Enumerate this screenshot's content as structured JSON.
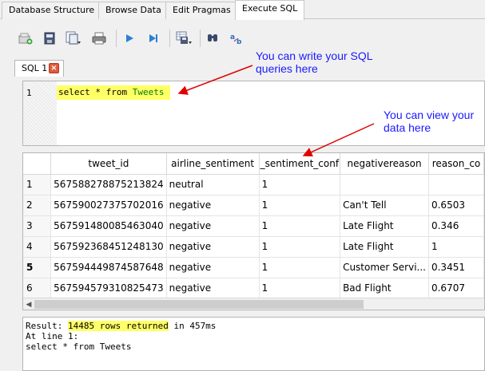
{
  "top_tabs": [
    "Database Structure",
    "Browse Data",
    "Edit Pragmas",
    "Execute SQL"
  ],
  "active_tab_index": 3,
  "toolbar_icons": [
    "open-tab-icon",
    "open-sql-icon",
    "save-sql-icon",
    "print-icon",
    "execute-all-icon",
    "execute-line-icon",
    "save-results-icon",
    "find-icon",
    "find-replace-icon"
  ],
  "sql_tab": {
    "label": "SQL 1"
  },
  "editor": {
    "line_number": "1",
    "query_keyword": "select * from ",
    "query_table": "Tweets"
  },
  "grid": {
    "columns": [
      "tweet_id",
      "airline_sentiment",
      "_sentiment_conf",
      "negativereason",
      "reason_co"
    ],
    "rows": [
      {
        "num": "1",
        "cells": [
          "567588278875213824",
          "neutral",
          "1",
          "",
          ""
        ]
      },
      {
        "num": "2",
        "cells": [
          "567590027375702016",
          "negative",
          "1",
          "Can't Tell",
          "0.6503"
        ]
      },
      {
        "num": "3",
        "cells": [
          "567591480085463040",
          "negative",
          "1",
          "Late Flight",
          "0.346"
        ]
      },
      {
        "num": "4",
        "cells": [
          "567592368451248130",
          "negative",
          "1",
          "Late Flight",
          "1"
        ]
      },
      {
        "num": "5",
        "cells": [
          "567594449874587648",
          "negative",
          "1",
          "Customer Servi...",
          "0.3451"
        ]
      },
      {
        "num": "6",
        "cells": [
          "567594579310825473",
          "negative",
          "1",
          "Bad Flight",
          "0.6707"
        ]
      }
    ]
  },
  "results": {
    "prefix": "Result: ",
    "rows_returned": "14485 rows returned",
    "suffix": " in 457ms",
    "line2": "At line 1:",
    "line3": "select * from Tweets"
  },
  "annotations": {
    "editor_note": "You can write your SQL queries here",
    "grid_note": "You can view your data here"
  },
  "colors": {
    "highlight": "#ffff66",
    "annotation": "#1a1aff",
    "arrow": "#e00000"
  }
}
